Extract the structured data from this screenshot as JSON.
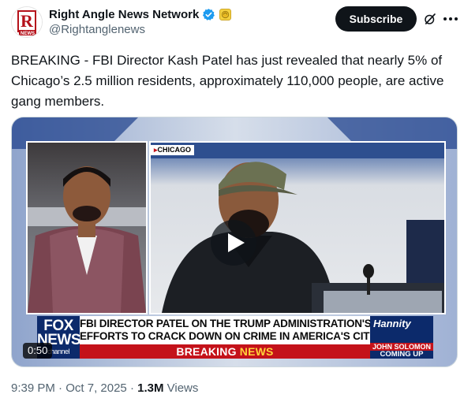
{
  "account": {
    "display_name": "Right Angle News Network",
    "handle": "@Rightanglenews",
    "avatar_letter": "R",
    "avatar_word": "NEWS"
  },
  "actions": {
    "subscribe_label": "Subscribe"
  },
  "tweet": {
    "text": "BREAKING - FBI Director Kash Patel has just revealed that nearly 5% of Chicago’s 2.5 million residents, approximately 110,000 people, are active gang members."
  },
  "video": {
    "duration": "0:50",
    "location_tag": "CHICAGO",
    "chyron_line1": "FBI DIRECTOR PATEL ON THE TRUMP ADMINISTRATION'S",
    "chyron_line2": "EFFORTS TO CRACK DOWN ON CRIME IN AMERICA'S CITIES",
    "breaking_word": "BREAKING ",
    "news_word": "NEWS",
    "network_logo_line1": "FOX",
    "network_logo_line2": "NEWS",
    "network_logo_line3": "channel",
    "show_name": "Hannity",
    "guest_name": "JOHN SOLOMON",
    "coming_up": "COMING UP"
  },
  "meta": {
    "time": "9:39 PM",
    "separator": " · ",
    "date": "Oct 7, 2025",
    "views_count": "1.3M",
    "views_label": " Views"
  },
  "colors": {
    "verified_badge": "#1d9bf0",
    "gold_badge": "#e8b923",
    "breaking_red": "#c4121a",
    "fox_blue": "#0c2a6b"
  },
  "icons": {
    "verified": "verified-badge-icon",
    "affiliate": "gold-affiliate-icon",
    "grok": "grok-icon",
    "more": "more-dots-icon",
    "play": "play-icon"
  }
}
